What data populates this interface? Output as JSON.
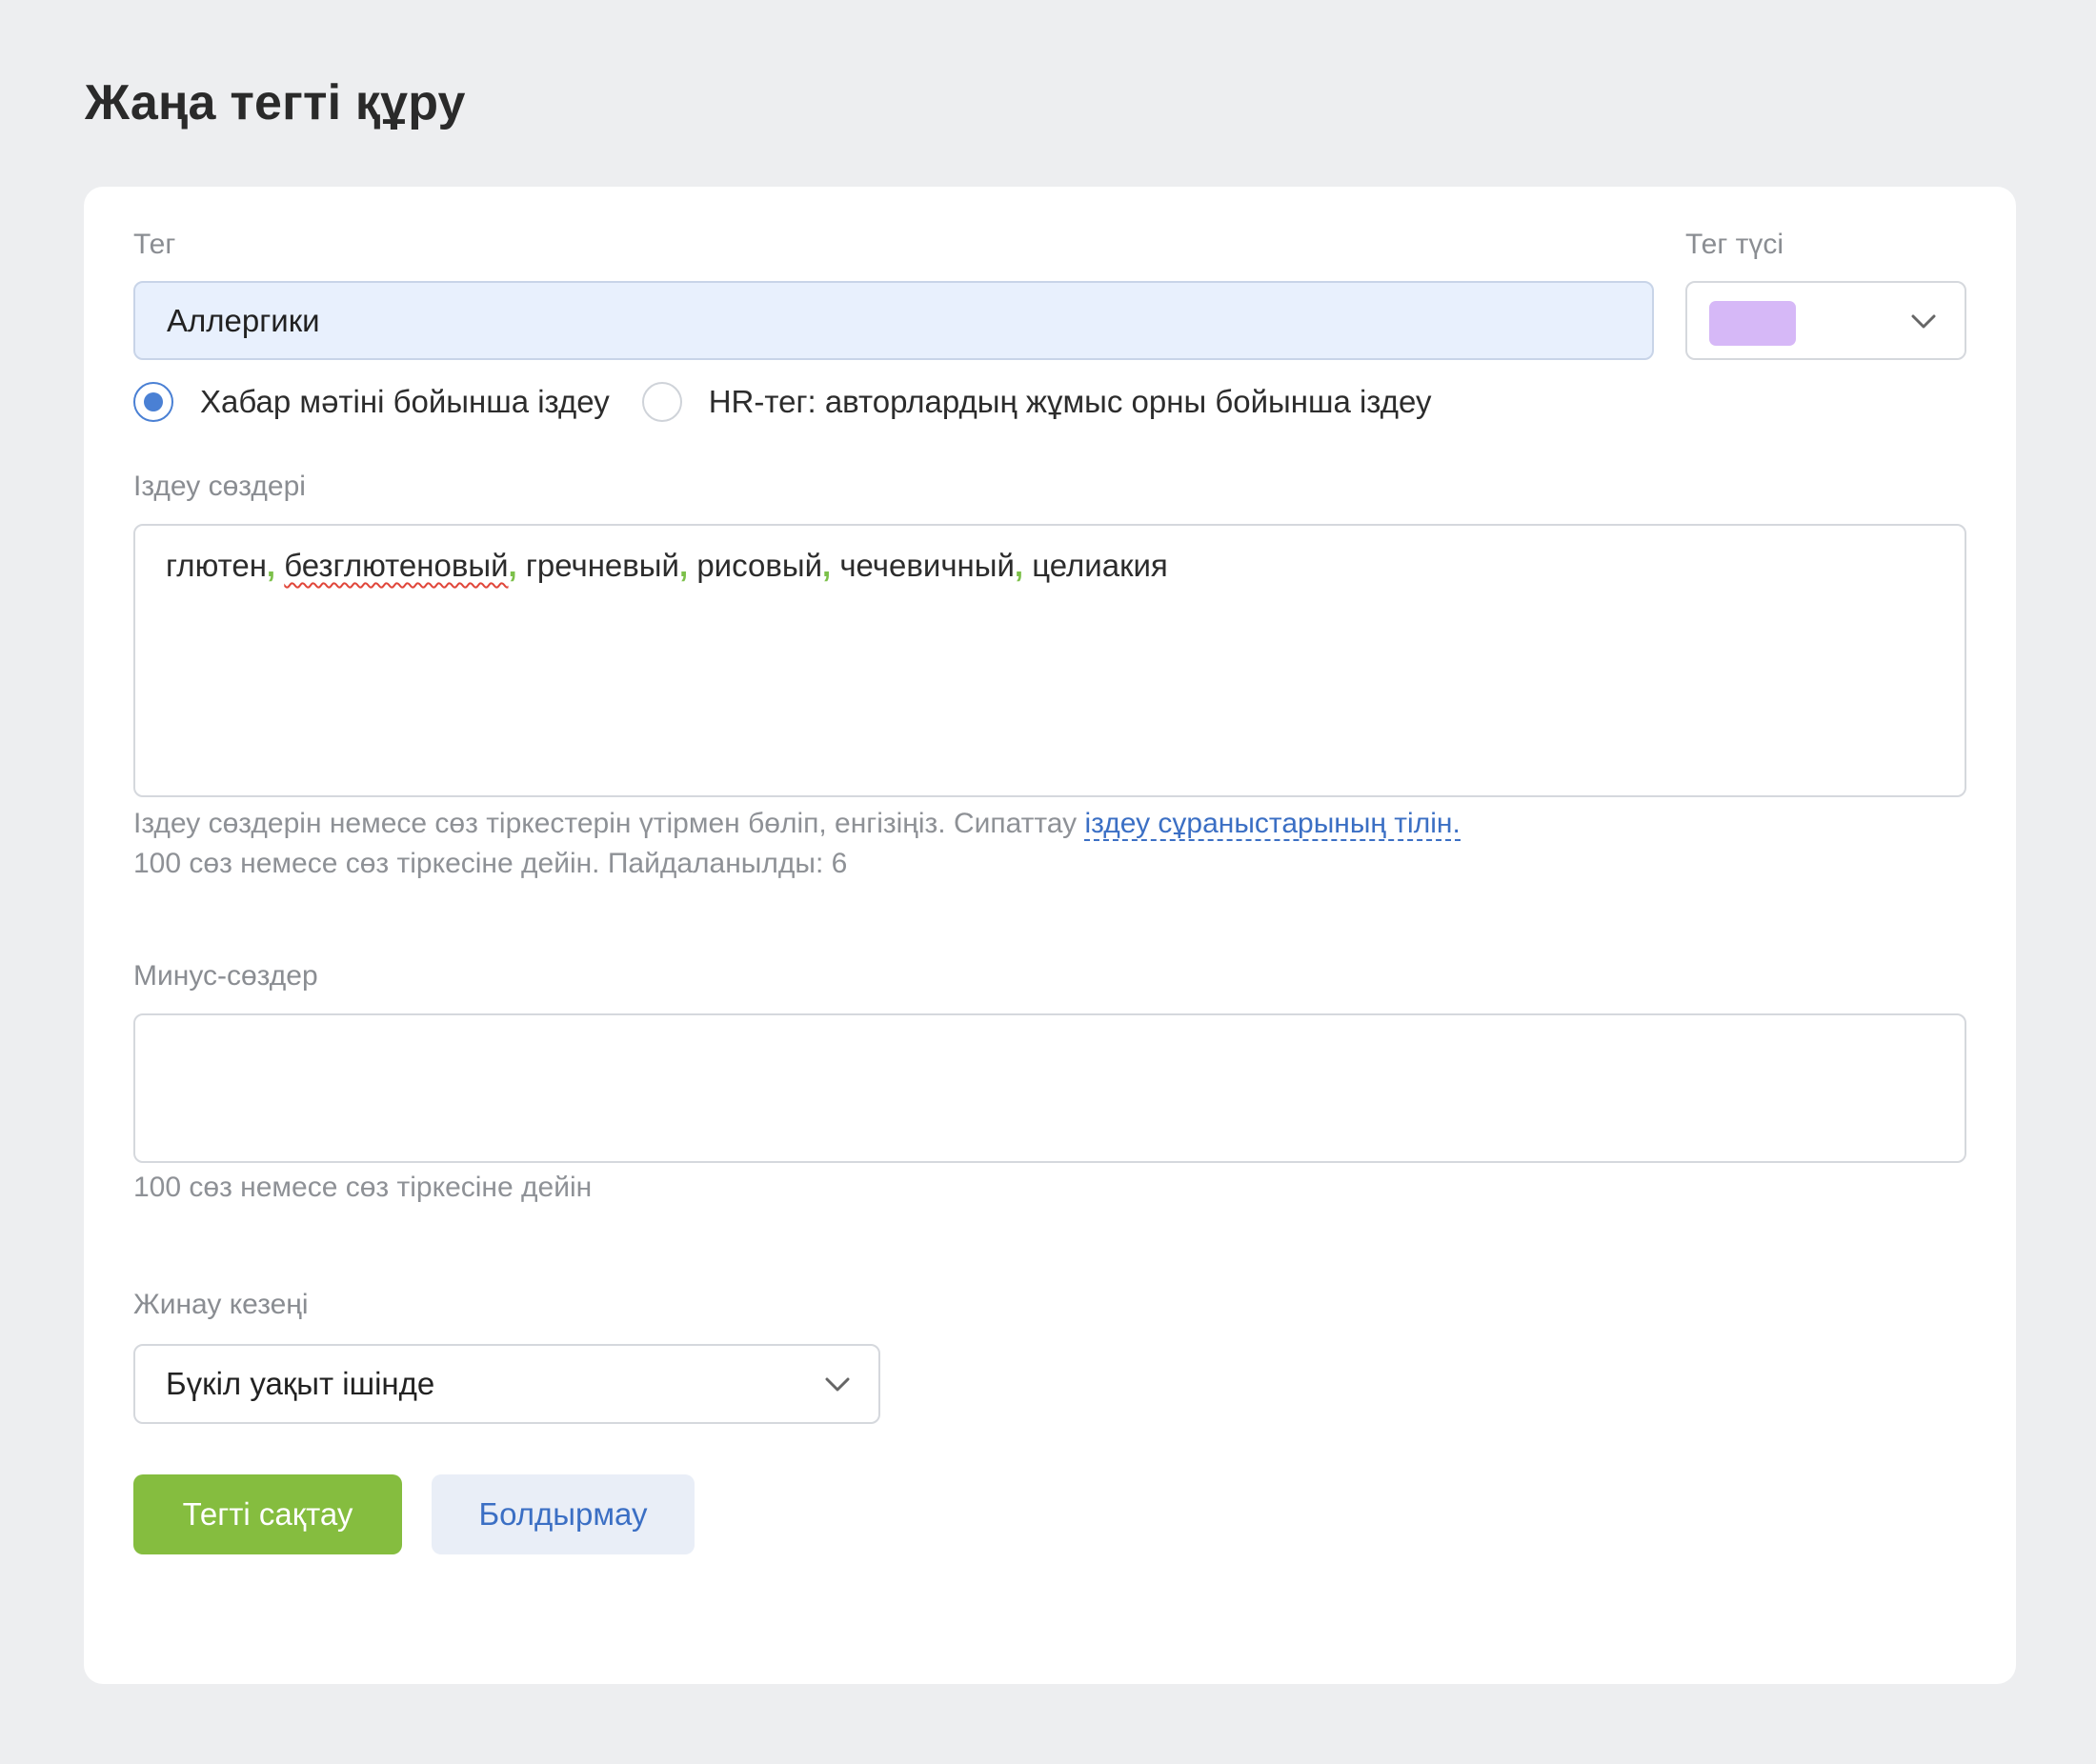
{
  "page": {
    "title": "Жаңа тегті құру"
  },
  "tag": {
    "label": "Тег",
    "value": "Аллергики"
  },
  "tag_color": {
    "label": "Тег түсі",
    "selected_color": "#d6b8f7",
    "icon": "chevron-down-icon"
  },
  "search_mode": {
    "options": [
      {
        "label": "Хабар мәтіні бойынша іздеу",
        "checked": true
      },
      {
        "label": "HR-тег: авторлардың жұмыс орны бойынша іздеу",
        "checked": false
      }
    ]
  },
  "keywords": {
    "label": "Іздеу сөздері",
    "words": [
      "глютен",
      "безглютеновый",
      "гречневый",
      "рисовый",
      "чечевичный",
      "целиакия"
    ],
    "separator": ",",
    "hint_line1": "Іздеу сөздерін немесе сөз тіркестерін үтірмен бөліп, енгізіңіз. Сипаттау ",
    "hint_link": "іздеу сұраныстарының тілін.",
    "hint_line2": "100 сөз немесе сөз тіркесіне дейін. Пайдаланылды: 6"
  },
  "minus_words": {
    "label": "Минус-сөздер",
    "value": "",
    "hint": "100 сөз немесе сөз тіркесіне дейін"
  },
  "period": {
    "label": "Жинау кезеңі",
    "value": "Бүкіл уақыт ішінде",
    "icon": "chevron-down-icon"
  },
  "buttons": {
    "save_label": "Тегті сақтау",
    "cancel_label": "Болдырмау"
  },
  "colors": {
    "accent_green": "#85bd3f",
    "link_blue": "#3b6fc4",
    "radio_blue": "#4a80d4",
    "separator_green": "#7cc04a"
  }
}
